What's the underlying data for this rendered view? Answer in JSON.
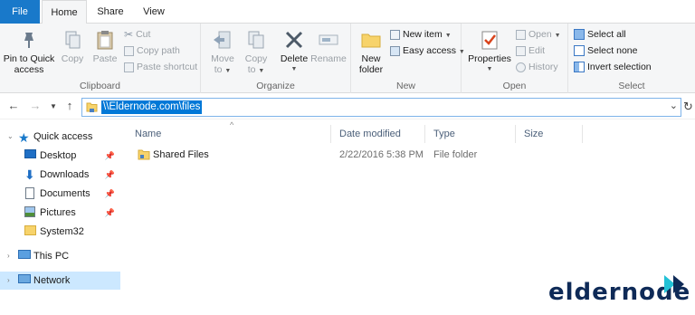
{
  "tabs": {
    "file": "File",
    "home": "Home",
    "share": "Share",
    "view": "View"
  },
  "ribbon": {
    "clipboard": {
      "label": "Clipboard",
      "pin_line1": "Pin to Quick",
      "pin_line2": "access",
      "copy": "Copy",
      "paste": "Paste",
      "cut": "Cut",
      "copy_path": "Copy path",
      "paste_shortcut": "Paste shortcut"
    },
    "organize": {
      "label": "Organize",
      "move_line1": "Move",
      "move_line2": "to",
      "copy_line1": "Copy",
      "copy_line2": "to",
      "delete": "Delete",
      "rename": "Rename"
    },
    "new": {
      "label": "New",
      "new_folder_line1": "New",
      "new_folder_line2": "folder",
      "new_item": "New item",
      "easy_access": "Easy access"
    },
    "open": {
      "label": "Open",
      "properties": "Properties",
      "open": "Open",
      "edit": "Edit",
      "history": "History"
    },
    "select": {
      "label": "Select",
      "select_all": "Select all",
      "select_none": "Select none",
      "invert": "Invert selection"
    }
  },
  "address": {
    "path": "\\\\Eldernode.com\\files"
  },
  "nav_pane": {
    "quick_access": "Quick access",
    "items": [
      {
        "label": "Desktop",
        "icon": "desktop-icon",
        "pinned": true
      },
      {
        "label": "Downloads",
        "icon": "download-icon",
        "pinned": true
      },
      {
        "label": "Documents",
        "icon": "documents-icon",
        "pinned": true
      },
      {
        "label": "Pictures",
        "icon": "pictures-icon",
        "pinned": true
      },
      {
        "label": "System32",
        "icon": "folder-icon",
        "pinned": false
      }
    ],
    "this_pc": "This PC",
    "network": "Network"
  },
  "columns": {
    "name": "Name",
    "date": "Date modified",
    "type": "Type",
    "size": "Size"
  },
  "files": [
    {
      "name": "Shared Files",
      "date": "2/22/2016 5:38 PM",
      "type": "File folder",
      "size": ""
    }
  ],
  "logo": {
    "text": "eldernode"
  },
  "colors": {
    "accent": "#1979ca",
    "selection": "#cce8ff",
    "address_highlight": "#0078d7",
    "folder": "#f7d36b"
  }
}
